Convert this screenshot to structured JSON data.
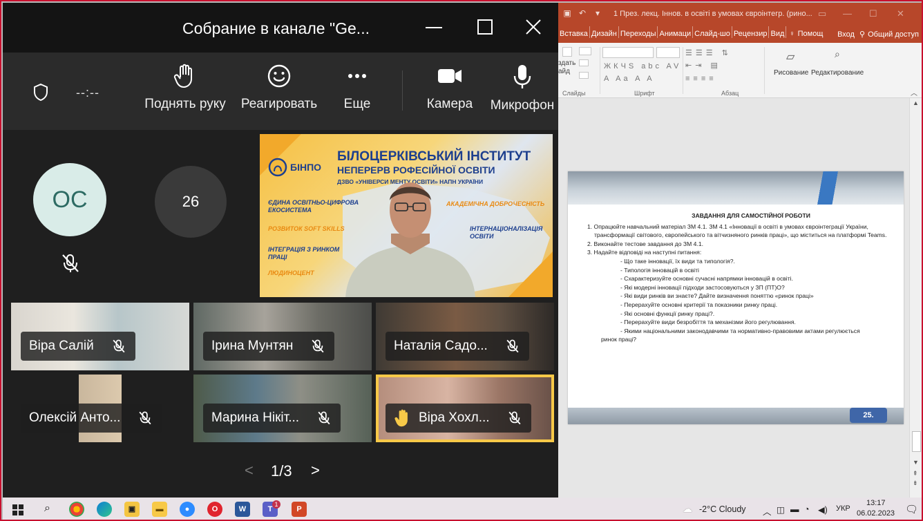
{
  "teams": {
    "title": "Собрание в канале \"Ge...",
    "timer": "--:--",
    "controls": {
      "raise_hand": "Поднять руку",
      "react": "Реагировать",
      "more": "Еще",
      "camera": "Камера",
      "mic": "Микрофон"
    },
    "avatars": [
      {
        "initials": "ОС",
        "muted": true
      },
      {
        "label": "26"
      }
    ],
    "presentation": {
      "logo_text": "БІНПО",
      "institute_line1": "БІЛОЦЕРКІВСЬКИЙ ІНСТИТУТ",
      "institute_line2": "НЕПЕРЕРВ      РОФЕСІЙНОЇ ОСВІТИ",
      "institute_line3": "ДЗВО «УНІВЕРСИ           МЕНТУ ОСВІТИ» НАПН УКРАЇНИ",
      "keywords": [
        "ЄДИНА ОСВІТНЬО-ЦИФРОВА",
        "ЕКОСИСТЕМА",
        "РОЗВИТОК SOFT SKILLS",
        "ІНТЕГРАЦІЯ З РИНКОМ",
        "ПРАЦІ",
        "ЛЮДИНОЦЕНТ",
        "АКАДЕМІЧНА ДОБРОЧЕСНІСТЬ",
        "ІНТЕРНАЦІОНАЛІЗАЦІЯ",
        "ОСВІТИ"
      ]
    },
    "participants": [
      {
        "name": "Віра Салій",
        "muted": true
      },
      {
        "name": "Ірина Мунтян",
        "muted": true
      },
      {
        "name": "Наталія Садо...",
        "muted": true
      },
      {
        "name": "Олексій Анто...",
        "muted": true
      },
      {
        "name": "Марина Нікіт...",
        "muted": true
      },
      {
        "name": "Віра Хохл...",
        "muted": true,
        "hand_raised": true
      }
    ],
    "pager": {
      "label": "1/3"
    }
  },
  "powerpoint": {
    "title": "1 През. лекц. Іннов. в освіті в умовах євроінтегр. (рино...",
    "tabs": [
      "Вставка",
      "Дизайн",
      "Переходы",
      "Анимаци",
      "Слайд-шо",
      "Рецензир",
      "Вид"
    ],
    "help": "Помощ",
    "signin": "Вход",
    "share": "Общий доступ",
    "ribbon": {
      "create_1": "здать",
      "create_2": "айд",
      "slides_group": "Слайды",
      "font_group": "Шрифт",
      "paragraph_group": "Абзац",
      "drawing": "Рисование",
      "editing": "Редактирование"
    },
    "slide": {
      "heading": "ЗАВДАННЯ ДЛЯ САМОСТІЙНОЇ РОБОТИ",
      "items": [
        "1. Опрацюйте навчальний матеріал ЗМ 4.1. ЗМ 4.1 «Інновації в освіті в умовах євроінтеграції України, трансформації світового, європейського та вітчизняного ринків праці», що міститься на платформі Teams.",
        "2. Виконайте тестове завдання до ЗМ 4.1.",
        "3. Надайте відповіді на наступні питання:"
      ],
      "questions": [
        "- Що таке інновації, їх види та типологія?.",
        "- Типологія інновацій в освіті",
        "- Схарактеризуйте основні сучасні напрямки інновацій в освіті.",
        "- Які модерні інновації підходи застосовуються у ЗП (ПТ)О?",
        "- Які види ринків ви знаєте? Дайте визначення поняттю «ринок праці»",
        "- Перерахуйте основні критерії та показники ринку праці.",
        "- Які основні функції ринку праці?.",
        "- Перерахуйте види безробіття та механізми його регулювання.",
        "- Якими національними законодавчими та нормативно-правовими актами регулюється"
      ],
      "last_line": "ринок праці?",
      "number": "25."
    }
  },
  "taskbar": {
    "weather": "-2°C  Cloudy",
    "lang": "УКР",
    "time": "13:17",
    "date": "06.02.2023",
    "teams_badge": "1"
  },
  "colors": {
    "ppt_accent": "#b7472a",
    "teams_bg": "#1f1f1f",
    "raised_hand": "#f7c948",
    "slide_number_bg": "#3f66a8"
  }
}
